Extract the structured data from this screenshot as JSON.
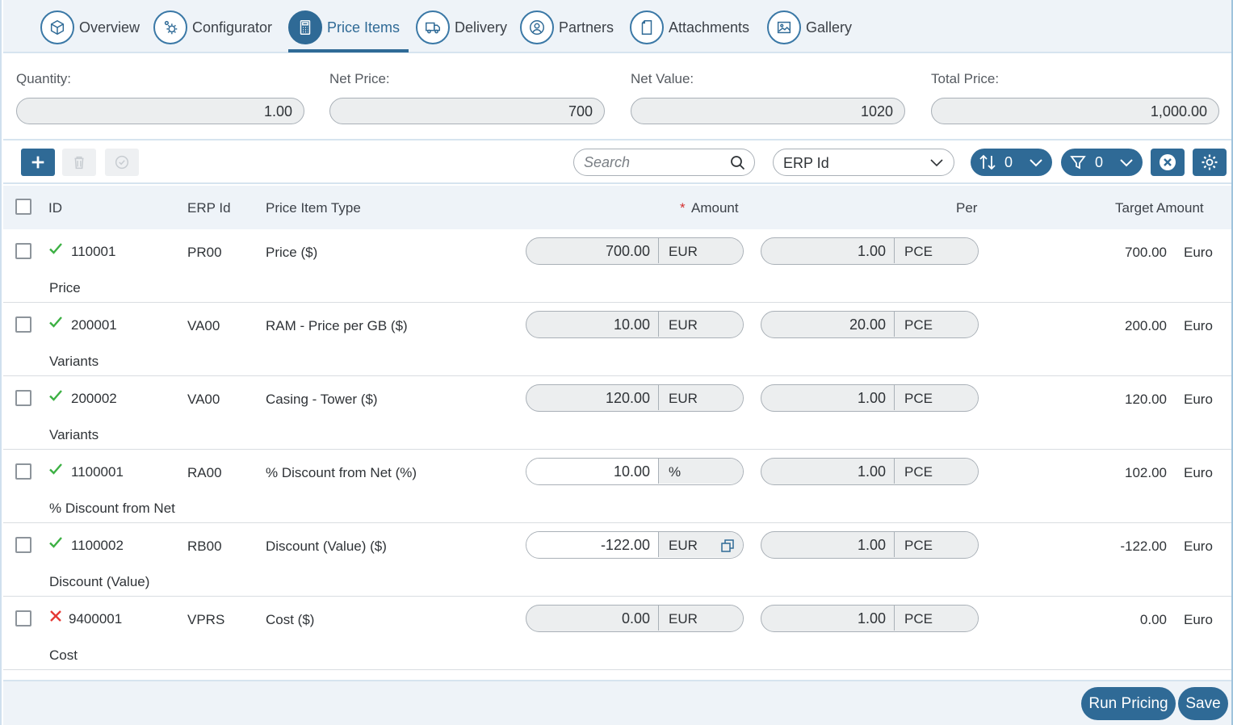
{
  "tabs": [
    {
      "label": "Overview",
      "icon": "cube-icon"
    },
    {
      "label": "Configurator",
      "icon": "gears-icon"
    },
    {
      "label": "Price Items",
      "icon": "calculator-icon",
      "active": true
    },
    {
      "label": "Delivery",
      "icon": "truck-icon"
    },
    {
      "label": "Partners",
      "icon": "user-circle-icon"
    },
    {
      "label": "Attachments",
      "icon": "document-icon"
    },
    {
      "label": "Gallery",
      "icon": "image-icon"
    }
  ],
  "summary": {
    "quantity": {
      "label": "Quantity:",
      "value": "1.00"
    },
    "net_price": {
      "label": "Net Price:",
      "value": "700"
    },
    "net_value": {
      "label": "Net Value:",
      "value": "1020"
    },
    "total_price": {
      "label": "Total Price:",
      "value": "1,000.00"
    }
  },
  "toolbar": {
    "search_placeholder": "Search",
    "search_field": "ERP Id",
    "sort_count": "0",
    "filter_count": "0"
  },
  "table": {
    "headers": {
      "id": "ID",
      "erp_id": "ERP Id",
      "type": "Price Item Type",
      "amount_required": "*",
      "amount": "Amount",
      "per": "Per",
      "target": "Target Amount"
    },
    "rows": [
      {
        "status": "ok",
        "id": "110001",
        "erp_id": "PR00",
        "type": "Price ($)",
        "category": "Price",
        "amount": "700.00",
        "amount_unit": "EUR",
        "amount_editable": false,
        "per": "1.00",
        "per_unit": "PCE",
        "target": "700.00",
        "currency": "Euro"
      },
      {
        "status": "ok",
        "id": "200001",
        "erp_id": "VA00",
        "type": "RAM - Price per GB ($)",
        "category": "Variants",
        "amount": "10.00",
        "amount_unit": "EUR",
        "amount_editable": false,
        "per": "20.00",
        "per_unit": "PCE",
        "target": "200.00",
        "currency": "Euro"
      },
      {
        "status": "ok",
        "id": "200002",
        "erp_id": "VA00",
        "type": "Casing - Tower ($)",
        "category": "Variants",
        "amount": "120.00",
        "amount_unit": "EUR",
        "amount_editable": false,
        "per": "1.00",
        "per_unit": "PCE",
        "target": "120.00",
        "currency": "Euro"
      },
      {
        "status": "ok",
        "id": "1100001",
        "erp_id": "RA00",
        "type": "% Discount from Net (%)",
        "category": "% Discount from Net",
        "amount": "10.00",
        "amount_unit": "%",
        "amount_editable": true,
        "per": "1.00",
        "per_unit": "PCE",
        "target": "102.00",
        "currency": "Euro"
      },
      {
        "status": "ok",
        "id": "1100002",
        "erp_id": "RB00",
        "type": "Discount (Value) ($)",
        "category": "Discount (Value)",
        "amount": "-122.00",
        "amount_unit": "EUR",
        "amount_editable": true,
        "per": "1.00",
        "per_unit": "PCE",
        "target": "-122.00",
        "currency": "Euro"
      },
      {
        "status": "error",
        "id": "9400001",
        "erp_id": "VPRS",
        "type": "Cost ($)",
        "category": "Cost",
        "amount": "0.00",
        "amount_unit": "EUR",
        "amount_editable": false,
        "per": "1.00",
        "per_unit": "PCE",
        "target": "0.00",
        "currency": "Euro"
      }
    ]
  },
  "footer": {
    "run_pricing": "Run Pricing",
    "save": "Save"
  },
  "colors": {
    "accent": "#2f6a96",
    "ok": "#3cb043",
    "error": "#e53935",
    "required": "#d32f2f"
  }
}
